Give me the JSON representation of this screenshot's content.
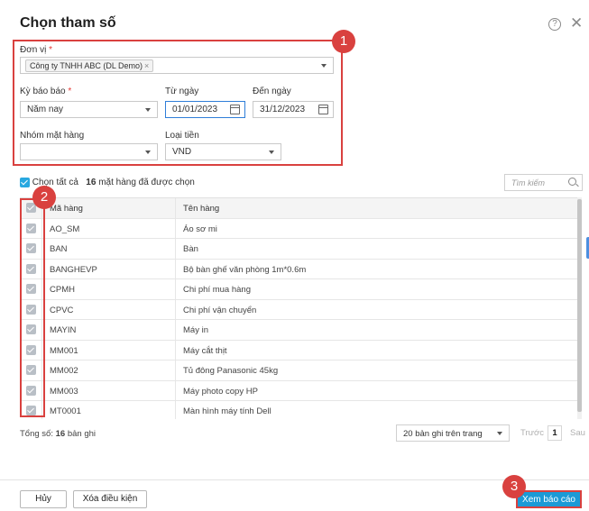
{
  "dialog": {
    "title": "Chọn tham số"
  },
  "params": {
    "unit": {
      "label": "Đơn vị",
      "tag": "Công ty TNHH ABC (DL Demo)"
    },
    "period": {
      "label": "Kỳ báo báo",
      "value": "Năm nay"
    },
    "from_date": {
      "label": "Từ ngày",
      "value": "01/01/2023"
    },
    "to_date": {
      "label": "Đến ngày",
      "value": "31/12/2023"
    },
    "item_group": {
      "label": "Nhóm mặt hàng",
      "value": ""
    },
    "currency": {
      "label": "Loại tiền",
      "value": "VND"
    },
    "required_mark": "*"
  },
  "callouts": [
    "1",
    "2",
    "3"
  ],
  "selection": {
    "select_all": "Chọn tất cả",
    "count": "16",
    "count_text": "mặt hàng đã được chọn"
  },
  "search": {
    "placeholder": "Tìm kiếm"
  },
  "grid": {
    "headers": [
      "Mã hàng",
      "Tên hàng"
    ],
    "rows": [
      {
        "code": "AO_SM",
        "name": "Áo sơ mi"
      },
      {
        "code": "BAN",
        "name": "Bàn"
      },
      {
        "code": "BANGHEVP",
        "name": "Bộ bàn ghế văn phòng 1m*0.6m"
      },
      {
        "code": "CPMH",
        "name": "Chi phí mua hàng"
      },
      {
        "code": "CPVC",
        "name": "Chi phí vận chuyển"
      },
      {
        "code": "MAYIN",
        "name": "Máy in"
      },
      {
        "code": "MM001",
        "name": "Máy cắt thịt"
      },
      {
        "code": "MM002",
        "name": "Tủ đông Panasonic 45kg"
      },
      {
        "code": "MM003",
        "name": "Máy photo copy HP"
      },
      {
        "code": "MT0001",
        "name": "Màn hình máy tính Dell"
      }
    ]
  },
  "footer": {
    "total_label": "Tổng số:",
    "total_value": "16",
    "total_unit": "bản ghi",
    "page_size": "20 bản ghi trên trang",
    "prev": "Trước",
    "page": "1",
    "next": "Sau"
  },
  "buttons": {
    "cancel": "Hủy",
    "clear": "Xóa điều kiện",
    "view_report": "Xem báo cáo"
  },
  "colors": {
    "accent": "#1b9ad6",
    "highlight": "#d9413f",
    "checkbox": "#29a8e0"
  }
}
